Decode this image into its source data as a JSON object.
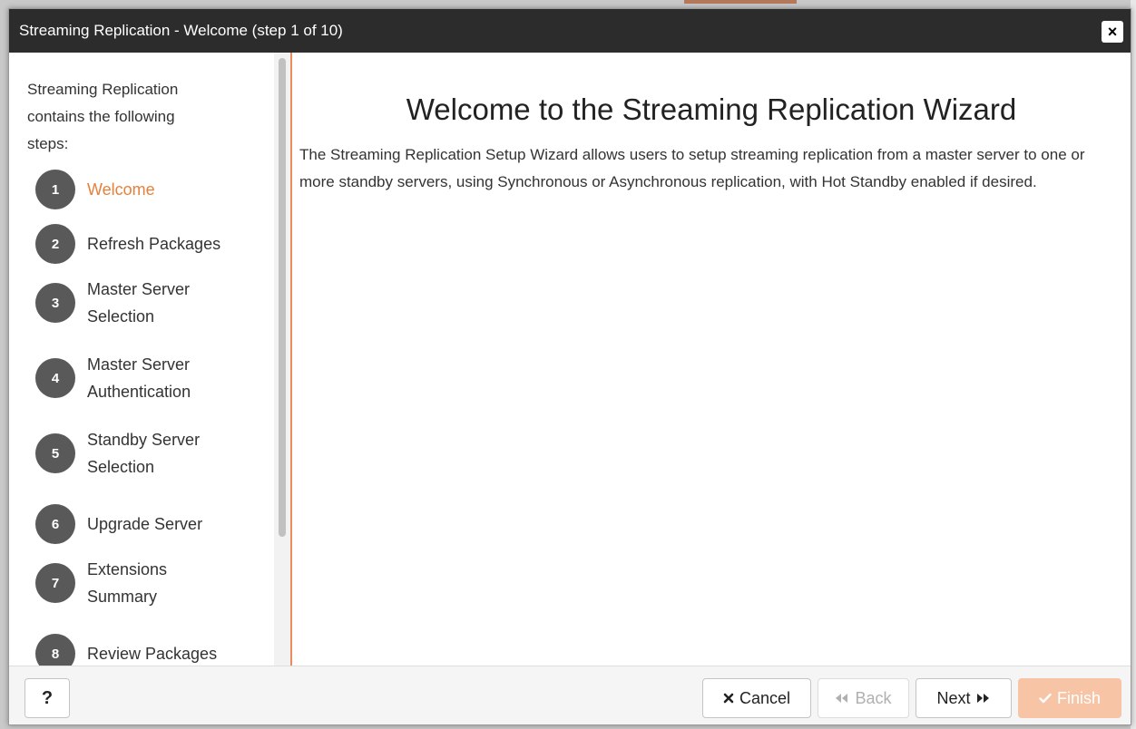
{
  "dialog": {
    "title": "Streaming Replication - Welcome (step 1 of 10)",
    "close_label": "×"
  },
  "sidebar": {
    "intro": "Streaming Replication contains the following steps:",
    "steps": [
      {
        "num": "1",
        "label": "Welcome",
        "active": true
      },
      {
        "num": "2",
        "label": "Refresh Packages"
      },
      {
        "num": "3",
        "label": "Master Server Selection"
      },
      {
        "num": "4",
        "label": "Master Server Authentication"
      },
      {
        "num": "5",
        "label": "Standby Server Selection"
      },
      {
        "num": "6",
        "label": "Upgrade Server"
      },
      {
        "num": "7",
        "label": "Extensions Summary"
      },
      {
        "num": "8",
        "label": "Review Packages"
      }
    ]
  },
  "main": {
    "heading": "Welcome to the Streaming Replication Wizard",
    "description": "The Streaming Replication Setup Wizard allows users to setup streaming replication from a master server to one or more standby servers, using Synchronous or Asynchronous replication, with Hot Standby enabled if desired."
  },
  "footer": {
    "help_label": "?",
    "cancel_label": "Cancel",
    "back_label": "Back",
    "next_label": "Next",
    "finish_label": "Finish"
  },
  "colors": {
    "accent": "#e6813c",
    "titlebar": "#2c2c2c",
    "step_circle": "#595959",
    "finish_disabled": "#f7c4a6"
  }
}
